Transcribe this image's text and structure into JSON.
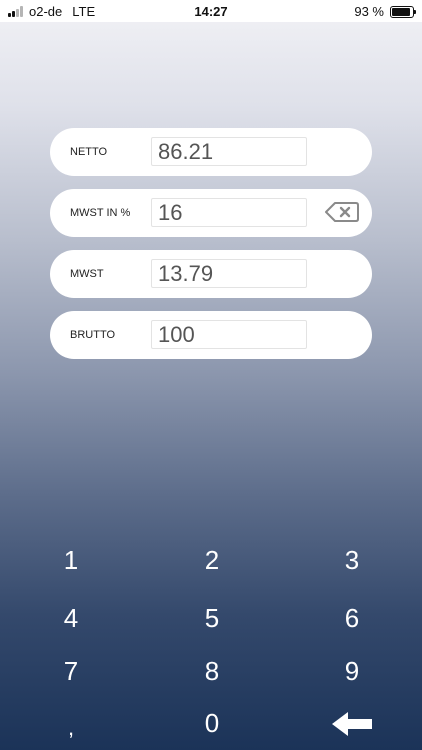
{
  "status_bar": {
    "carrier": "o2-de",
    "network": "LTE",
    "time": "14:27",
    "battery": "93 %"
  },
  "fields": [
    {
      "label": "NETTO",
      "value": "86.21"
    },
    {
      "label": "MWST IN %",
      "value": "16"
    },
    {
      "label": "MWST",
      "value": "13.79"
    },
    {
      "label": "BRUTTO",
      "value": "100"
    }
  ],
  "keypad": {
    "k1": "1",
    "k2": "2",
    "k3": "3",
    "k4": "4",
    "k5": "5",
    "k6": "6",
    "k7": "7",
    "k8": "8",
    "k9": "9",
    "comma": ",",
    "k0": "0",
    "backspace_icon": "arrow-left-icon"
  },
  "icons": {
    "clear": "backspace-clear-icon"
  },
  "colors": {
    "keypad_text": "#ffffff",
    "gradient_top": "#f2f2f6",
    "gradient_bottom": "#1b3358"
  }
}
